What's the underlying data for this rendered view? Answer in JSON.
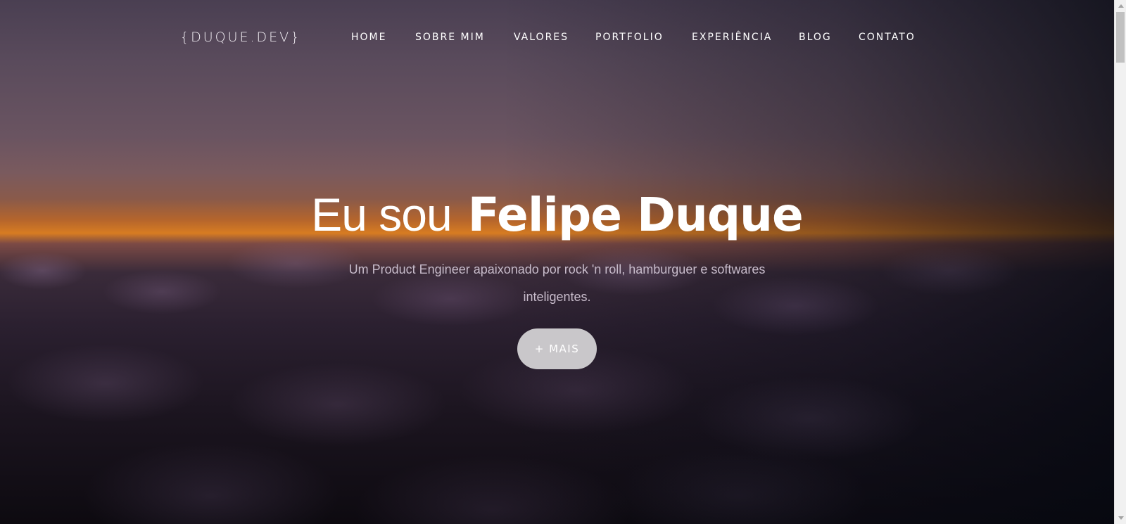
{
  "brand": {
    "logo_text": "{DUQUE.DEV}"
  },
  "nav": {
    "items": [
      {
        "label": "HOME"
      },
      {
        "label": "SOBRE MIM"
      },
      {
        "label": "VALORES"
      },
      {
        "label": "PORTFOLIO"
      },
      {
        "label": "EXPERIÊNCIA"
      },
      {
        "label": "BLOG"
      },
      {
        "label": "CONTATO"
      }
    ],
    "theme_toggle_icon": "moon-icon"
  },
  "hero": {
    "headline_prefix": "Eu sou",
    "headline_name": "Felipe Duque",
    "tagline": "Um Product Engineer apaixonado por rock 'n roll, hamburguer e softwares inteligentes.",
    "cta_label": "+ MAIS"
  },
  "colors": {
    "cta_background": "#c9c7ca",
    "tagline_text": "#c8bccb",
    "horizon_glow": "#d77c22"
  }
}
